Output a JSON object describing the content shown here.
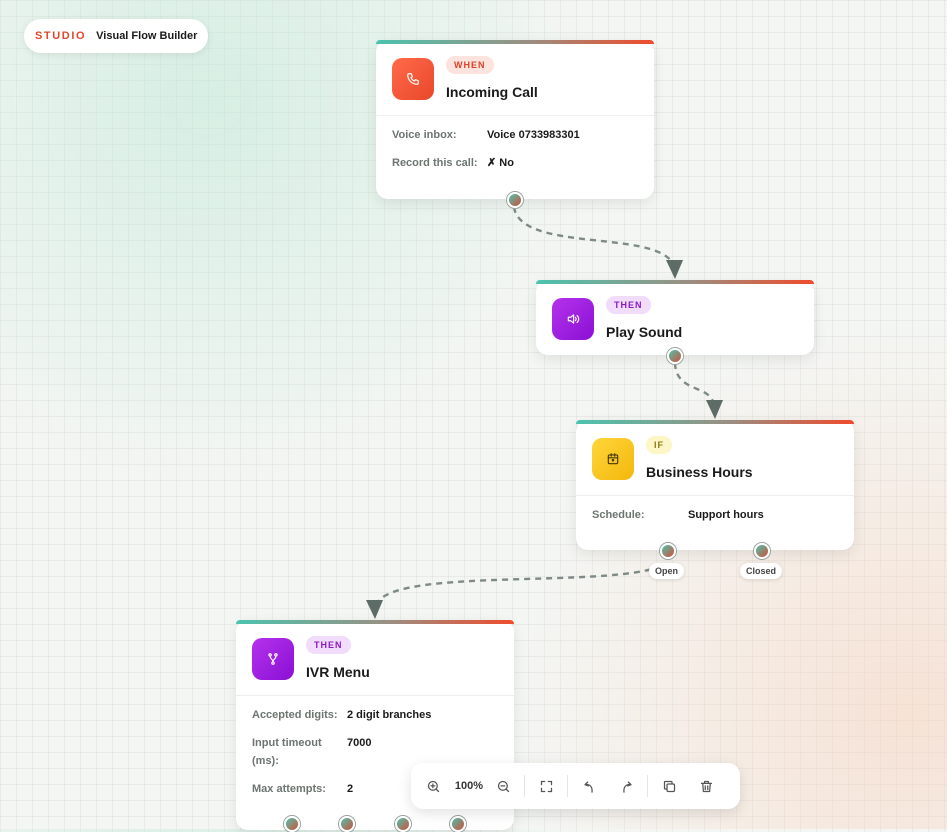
{
  "brand": {
    "studio": "STUDIO",
    "title": "Visual Flow Builder"
  },
  "nodes": {
    "incoming_call": {
      "badge": "WHEN",
      "title": "Incoming Call",
      "icon": "phone-icon",
      "fields": [
        {
          "label": "Voice inbox:",
          "value": "Voice 0733983301"
        },
        {
          "label": "Record this call:",
          "value": "✗ No"
        }
      ]
    },
    "play_sound": {
      "badge": "THEN",
      "title": "Play Sound",
      "icon": "speaker-icon"
    },
    "business_hours": {
      "badge": "IF",
      "title": "Business Hours",
      "icon": "calendar-icon",
      "fields": [
        {
          "label": "Schedule:",
          "value": "Support hours"
        }
      ],
      "ports": [
        "Open",
        "Closed"
      ]
    },
    "ivr_menu": {
      "badge": "THEN",
      "title": "IVR Menu",
      "icon": "branch-icon",
      "fields": [
        {
          "label": "Accepted digits:",
          "value": "2 digit branches"
        },
        {
          "label": "Input timeout (ms):",
          "value": "7000"
        },
        {
          "label": "Max attempts:",
          "value": "2"
        }
      ]
    }
  },
  "toolbar": {
    "zoom": "100%",
    "icons": [
      "zoom-in-icon",
      "zoom-out-icon",
      "fit-view-icon",
      "undo-icon",
      "redo-icon",
      "duplicate-icon",
      "delete-icon"
    ]
  },
  "colors": {
    "accent": "#e0482a",
    "teal": "#4cc3ae",
    "purple": "#9a1ed8",
    "yellow": "#f6c21a"
  }
}
